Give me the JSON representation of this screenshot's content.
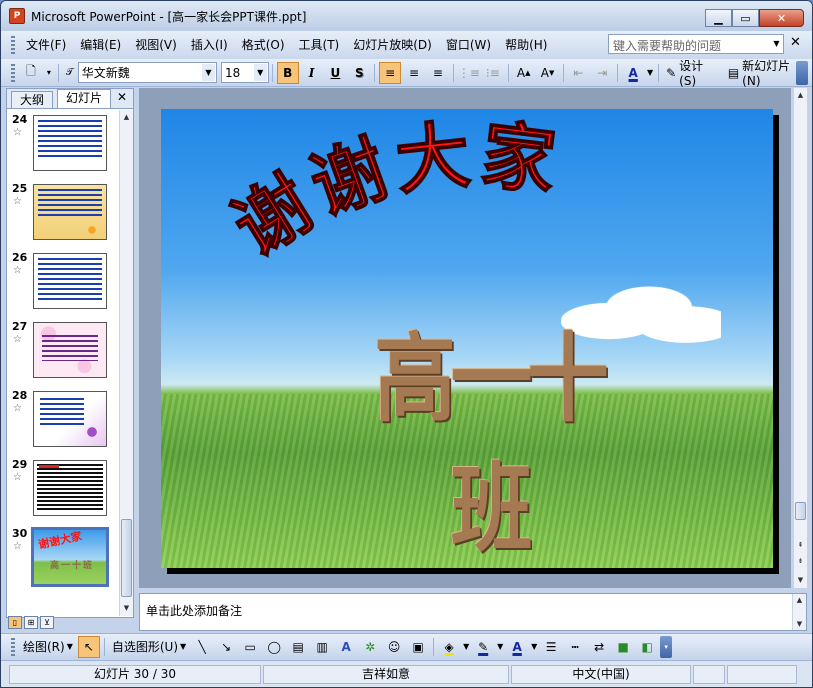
{
  "window": {
    "title": "Microsoft PowerPoint - [高一家长会PPT课件.ppt]",
    "app_icon": "P"
  },
  "menubar": {
    "items": [
      "文件(F)",
      "编辑(E)",
      "视图(V)",
      "插入(I)",
      "格式(O)",
      "工具(T)",
      "幻灯片放映(D)",
      "窗口(W)",
      "帮助(H)"
    ],
    "help_placeholder": "键入需要帮助的问题"
  },
  "toolbar": {
    "font_name": "华文新魏",
    "font_size": "18",
    "bold": "B",
    "italic": "I",
    "underline": "U",
    "shadow": "S",
    "design_label": "设计(S)",
    "new_slide_label": "新幻灯片(N)"
  },
  "left_pane": {
    "tabs": [
      "大纲",
      "幻灯片"
    ],
    "thumbnails": [
      {
        "num": "24",
        "style": "blue-text"
      },
      {
        "num": "25",
        "style": "orange-flowers"
      },
      {
        "num": "26",
        "style": "blue-text"
      },
      {
        "num": "27",
        "style": "pink-circles"
      },
      {
        "num": "28",
        "style": "purple-flowers"
      },
      {
        "num": "29",
        "style": "dense-text"
      },
      {
        "num": "30",
        "style": "current-slide"
      }
    ]
  },
  "slide": {
    "title": "谢谢大家",
    "subtitle": "高一十班",
    "title_color": "#ff1414",
    "subtitle_color": "#a57a52"
  },
  "notes": {
    "placeholder": "单击此处添加备注"
  },
  "drawbar": {
    "draw_label": "绘图(R)",
    "autoshapes_label": "自选图形(U)"
  },
  "status": {
    "slide_info": "幻灯片 30 / 30",
    "design": "吉祥如意",
    "language": "中文(中国)"
  }
}
